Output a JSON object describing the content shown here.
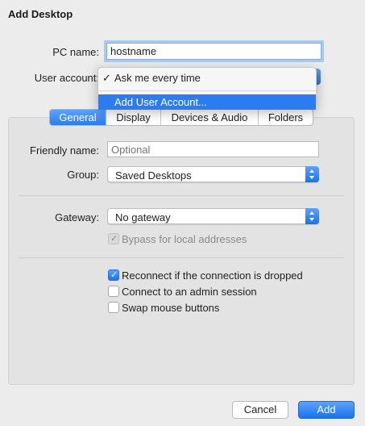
{
  "window": {
    "title": "Add Desktop"
  },
  "pc_name": {
    "label": "PC name:",
    "value": "hostname"
  },
  "user_account": {
    "label": "User account:",
    "menu": [
      {
        "label": "Ask me every time",
        "checked": true
      },
      {
        "label": "Add User Account...",
        "highlighted": true
      }
    ]
  },
  "tabs": [
    {
      "label": "General",
      "active": true
    },
    {
      "label": "Display"
    },
    {
      "label": "Devices & Audio"
    },
    {
      "label": "Folders"
    }
  ],
  "general": {
    "friendly_name": {
      "label": "Friendly name:",
      "placeholder": "Optional"
    },
    "group": {
      "label": "Group:",
      "value": "Saved Desktops"
    },
    "gateway": {
      "label": "Gateway:",
      "value": "No gateway"
    },
    "bypass": {
      "label": "Bypass for local addresses",
      "checked": true,
      "disabled": true
    },
    "options": [
      {
        "label": "Reconnect if the connection is dropped",
        "checked": true
      },
      {
        "label": "Connect to an admin session",
        "checked": false
      },
      {
        "label": "Swap mouse buttons",
        "checked": false
      }
    ]
  },
  "buttons": {
    "cancel": "Cancel",
    "add": "Add"
  },
  "colors": {
    "accent": "#2a7cf0",
    "focus_ring": "#a9c9f5",
    "background": "#ececec"
  }
}
